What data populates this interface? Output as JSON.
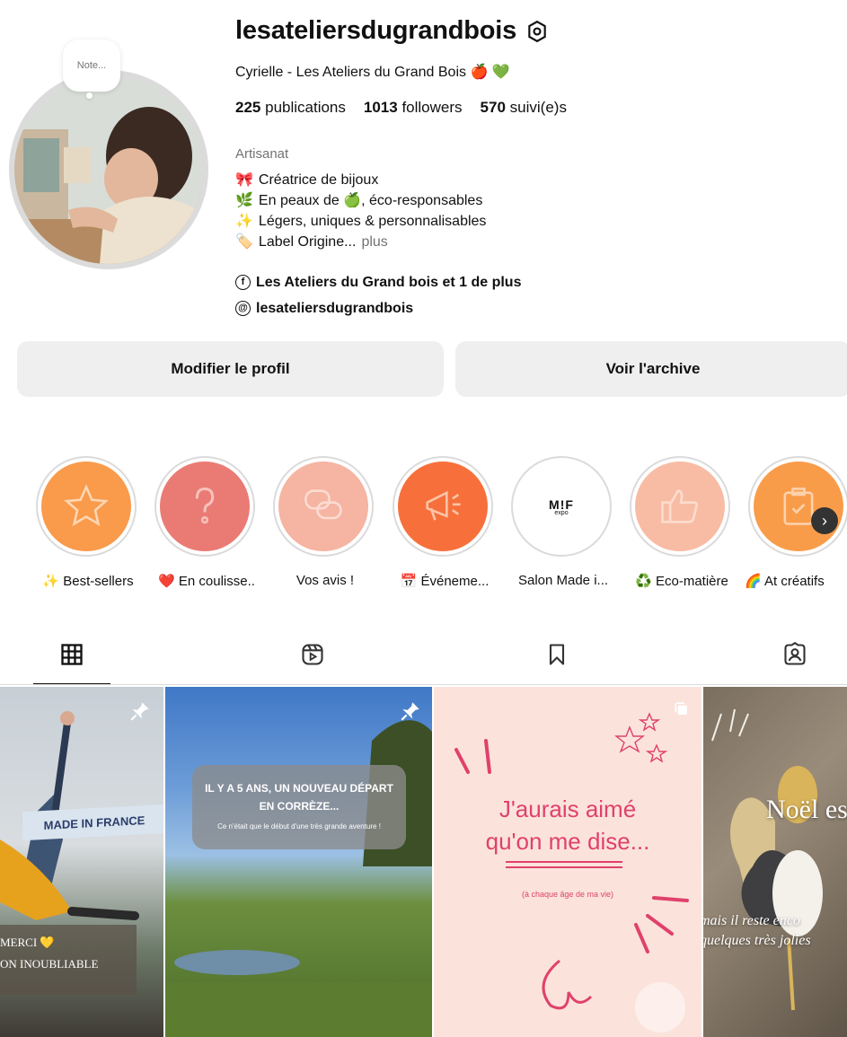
{
  "profile": {
    "note": "Note...",
    "username": "lesateliersdugrandbois",
    "display_name": "Cyrielle - Les Ateliers du Grand Bois",
    "stats": {
      "posts_count": "225",
      "posts_label": "publications",
      "followers_count": "1013",
      "followers_label": "followers",
      "following_count": "570",
      "following_label": "suivi(e)s"
    },
    "category": "Artisanat",
    "bio": [
      {
        "emoji": "🎀",
        "text": "Créatrice de bijoux"
      },
      {
        "emoji": "🌿",
        "text": "En peaux de 🍏, éco-responsables"
      },
      {
        "emoji": "✨",
        "text": "Légers, uniques & personnalisables"
      },
      {
        "emoji": "🏷️",
        "text": "Label Origine..."
      }
    ],
    "bio_more": "plus",
    "links": {
      "facebook": "Les Ateliers du Grand bois et 1 de plus",
      "threads": "lesateliersdugrandbois"
    }
  },
  "buttons": {
    "edit_profile": "Modifier le profil",
    "archive": "Voir l'archive"
  },
  "highlights": [
    {
      "label": "✨ Best-sellers",
      "color": "#f99b4b"
    },
    {
      "label": "❤️ En coulisse..",
      "color": "#ea7b74"
    },
    {
      "label": "Vos avis !",
      "color": "#f6b4a2"
    },
    {
      "label": "📅 Événeme...",
      "color": "#f7703b"
    },
    {
      "label": "Salon Made i...",
      "logo": "M!F",
      "logo_sub": "expo",
      "color": "#ffffff"
    },
    {
      "label": "♻️ Eco-matière",
      "color": "#f8bca4"
    },
    {
      "label": "🌈 At créatifs",
      "color": "#f99c4a"
    }
  ],
  "tabs": [
    "grid-icon",
    "reels-icon",
    "saved-icon",
    "tagged-icon"
  ],
  "posts": [
    {
      "banner": "MADE IN FRANCE",
      "caption1": "MERCI 💛",
      "caption2": "ON INOUBLIABLE"
    },
    {
      "headline": "IL Y A 5 ANS, UN NOUVEAU DÉPART EN CORRÈZE...",
      "subline": "Ce n'était que le début d'une très grande aventure !"
    },
    {
      "headline1": "J'aurais aimé",
      "headline2": "qu'on me dise...",
      "subline": "(à chaque âge de ma vie)"
    },
    {
      "headline": "Noël est",
      "script1": "mais il reste enco",
      "script2": "quelques très jolies"
    }
  ],
  "colors": {
    "accent_pink": "#e0416b",
    "button_bg": "#efefef",
    "muted": "#737373"
  }
}
